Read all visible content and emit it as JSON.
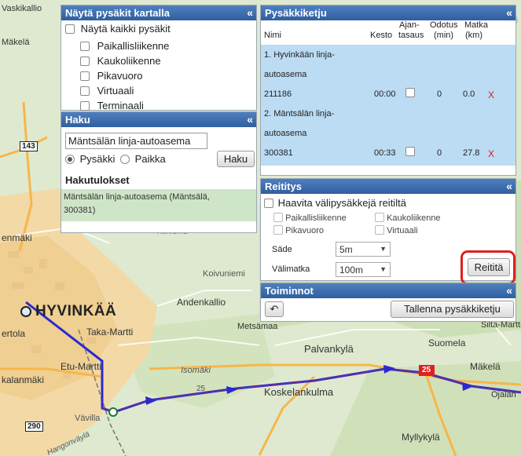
{
  "map": {
    "places": {
      "vaskikallio": "Vaskikallio",
      "makela_w": "Mäkelä",
      "enmaki": "enmäki",
      "hyvinkaa": "HYVINKÄÄ",
      "taka_martti": "Taka-Martti",
      "etu_martti": "Etu-Martti",
      "kalanmaki": "kalanmäki",
      "ertola": "ertola",
      "varvilla": "Vävilla",
      "hangonvayla": "Hangonväylä",
      "andenkallio": "Andenkallio",
      "metsamaa": "Metsämaa",
      "isomaki": "Isomäki",
      "koskelankulma": "Koskelankulma",
      "palvankyla": "Palvankylä",
      "suomela": "Suomela",
      "makela_e": "Mäkelä",
      "silta_martti": "Silta-Martti",
      "ojalan": "Ojalan",
      "myllykyla": "Myllykylä",
      "koivuniemi": "Koivuniemi",
      "koivuma": "Koivumä"
    },
    "roads": {
      "r143": "143",
      "r290": "290",
      "r25": "25",
      "r25b": "25"
    }
  },
  "show_stops": {
    "title": "Näytä pysäkit kartalla",
    "all_label": "Näytä kaikki pysäkit",
    "types": [
      "Paikallisliikenne",
      "Kaukoliikenne",
      "Pikavuoro",
      "Virtuaali",
      "Terminaali"
    ]
  },
  "search": {
    "title": "Haku",
    "query": "Mäntsälän linja-autoasema",
    "opt_stop": "Pysäkki",
    "opt_place": "Paikka",
    "button": "Haku",
    "results_title": "Hakutulokset",
    "result_line1": "Mäntsälän linja-autoasema (Mäntsälä,",
    "result_line2": "300381)"
  },
  "chain": {
    "title": "Pysäkkiketju",
    "headers": {
      "name": "Nimi",
      "duration": "Kesto",
      "timing_1": "Ajan-",
      "timing_2": "tasaus",
      "wait_1": "Odotus",
      "wait_2": "(min)",
      "dist_1": "Matka",
      "dist_2": "(km)"
    },
    "rows": [
      {
        "name_1": "1. Hyvinkään linja-",
        "name_2": "autoasema",
        "code": "211186",
        "duration": "00:00",
        "wait": "0",
        "dist": "0.0",
        "remove": "X"
      },
      {
        "name_1": "2. Mäntsälän linja-",
        "name_2": "autoasema",
        "code": "300381",
        "duration": "00:33",
        "wait": "0",
        "dist": "27.8",
        "remove": "X"
      }
    ]
  },
  "routing": {
    "title": "Reititys",
    "hide_label": "Haavita välipysäkkejä reitiltä",
    "types": [
      "Paikallisliikenne",
      "Kaukoliikenne",
      "Pikavuoro",
      "Virtuaali"
    ],
    "radius_label": "Säde",
    "radius_value": "5m",
    "interval_label": "Välimatka",
    "interval_value": "100m",
    "button": "Reititä"
  },
  "actions": {
    "title": "Toiminnot",
    "undo_icon": "↶",
    "save_button": "Tallenna pysäkkiketju"
  },
  "icons": {
    "collapse": "«"
  },
  "colors": {
    "header": "#2f5f9f",
    "row_selected": "#bcdcf4",
    "result_bg": "#cfe5c7",
    "route": "#2a2ad0",
    "highlight": "#e02020"
  }
}
